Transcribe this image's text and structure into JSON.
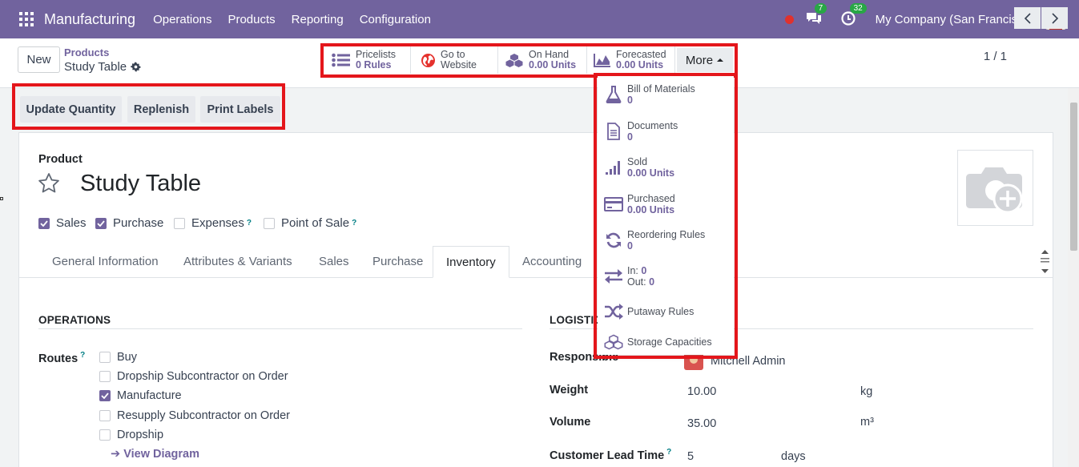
{
  "navbar": {
    "app_name": "Manufacturing",
    "menu": [
      "Operations",
      "Products",
      "Reporting",
      "Configuration"
    ],
    "chat_badge": "7",
    "activity_badge": "32",
    "company": "My Company (San Francisco)"
  },
  "control": {
    "new_label": "New",
    "breadcrumb_parent": "Products",
    "breadcrumb_current": "Study Table",
    "pager": "1 / 1"
  },
  "smart_buttons": [
    {
      "label": "Pricelists",
      "value": "0 Rules",
      "icon": "list-icon"
    },
    {
      "label": "Go to",
      "value": "Website",
      "icon": "globe-icon"
    },
    {
      "label": "On Hand",
      "value": "0.00 Units",
      "icon": "cubes-icon"
    },
    {
      "label": "Forecasted",
      "value": "0.00 Units",
      "icon": "area-chart-icon"
    }
  ],
  "more_label": "More",
  "more_menu": [
    {
      "label": "Bill of Materials",
      "value": "0",
      "icon": "flask-icon"
    },
    {
      "label": "Documents",
      "value": "0",
      "icon": "document-icon"
    },
    {
      "label": "Sold",
      "value": "0.00 Units",
      "icon": "signal-icon"
    },
    {
      "label": "Purchased",
      "value": "0.00 Units",
      "icon": "credit-card-icon"
    },
    {
      "label": "Reordering Rules",
      "value": "0",
      "icon": "refresh-icon"
    },
    {
      "label_in": "In:",
      "value_in": "0",
      "label_out": "Out:",
      "value_out": "0",
      "icon": "exchange-icon"
    },
    {
      "label": "Putaway Rules",
      "icon": "random-icon"
    },
    {
      "label": "Storage Capacities",
      "icon": "cubes-icon"
    }
  ],
  "actions": [
    "Update Quantity",
    "Replenish",
    "Print Labels"
  ],
  "form": {
    "product_label": "Product",
    "name": "Study Table",
    "checks": [
      {
        "label": "Sales",
        "checked": true
      },
      {
        "label": "Purchase",
        "checked": true
      },
      {
        "label": "Expenses",
        "checked": false,
        "help": "?"
      },
      {
        "label": "Point of Sale",
        "checked": false,
        "help": "?"
      }
    ],
    "tabs": [
      "General Information",
      "Attributes & Variants",
      "Sales",
      "Purchase",
      "Inventory",
      "Accounting"
    ],
    "active_tab": "Inventory",
    "operations_title": "OPERATIONS",
    "routes_label": "Routes",
    "routes": [
      {
        "label": "Buy",
        "checked": false
      },
      {
        "label": "Dropship Subcontractor on Order",
        "checked": false
      },
      {
        "label": "Manufacture",
        "checked": true
      },
      {
        "label": "Resupply Subcontractor on Order",
        "checked": false
      },
      {
        "label": "Dropship",
        "checked": false
      }
    ],
    "view_diagram": "View Diagram",
    "logistics_title": "LOGISTICS",
    "responsible_label": "Responsible",
    "responsible_value": "Mitchell Admin",
    "weight_label": "Weight",
    "weight_value": "10.00",
    "weight_unit": "kg",
    "volume_label": "Volume",
    "volume_value": "35.00",
    "volume_unit": "m³",
    "lead_time_label": "Customer Lead Time",
    "lead_time_value": "5",
    "lead_time_unit": "days"
  },
  "colors": {
    "brand": "#71639e",
    "highlight": "#e4161b",
    "badge": "#28a745"
  }
}
